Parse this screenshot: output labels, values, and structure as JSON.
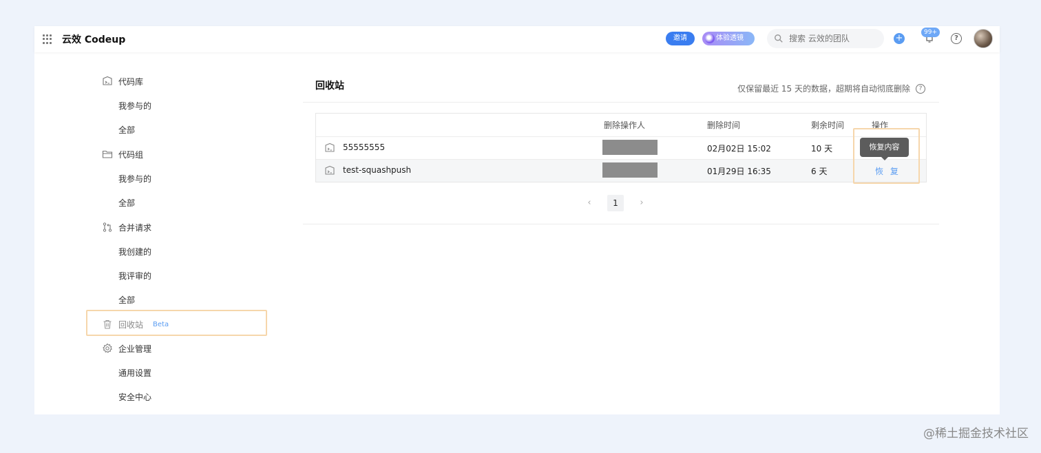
{
  "topbar": {
    "app_title": "云效 Codeup",
    "invite_label": "邀请",
    "tryout_label": "体验透镜",
    "search_placeholder": "搜索 云效的团队",
    "notification_badge": "99+",
    "help_label": "?"
  },
  "sidebar": {
    "repos": {
      "label": "代码库",
      "sub": [
        "我参与的",
        "全部"
      ]
    },
    "groups": {
      "label": "代码组",
      "sub": [
        "我参与的",
        "全部"
      ]
    },
    "merge_requests": {
      "label": "合并请求",
      "sub": [
        "我创建的",
        "我评审的",
        "全部"
      ]
    },
    "recycle_bin": {
      "label": "回收站",
      "badge": "Beta"
    },
    "enterprise": {
      "label": "企业管理",
      "sub": [
        "通用设置",
        "安全中心"
      ]
    }
  },
  "main": {
    "title": "回收站",
    "notice": "仅保留最近 15 天的数据，超期将自动彻底删除",
    "columns": [
      "删除操作人",
      "删除时间",
      "剩余时间",
      "操作"
    ],
    "rows": [
      {
        "name": "55555555",
        "deleted_at": "02月02日 15:02",
        "remaining": "10 天",
        "action": ""
      },
      {
        "name": "test-squashpush",
        "deleted_at": "01月29日 16:35",
        "remaining": "6 天",
        "action": "恢 复"
      }
    ],
    "tooltip": "恢复内容",
    "pagination": {
      "prev": "‹",
      "current": "1",
      "next": "›"
    }
  },
  "watermark": "@稀土掘金技术社区",
  "colors": {
    "accent": "#5a9cf2",
    "highlight": "#f6d6ab",
    "page_bg": "#eef3fb"
  }
}
